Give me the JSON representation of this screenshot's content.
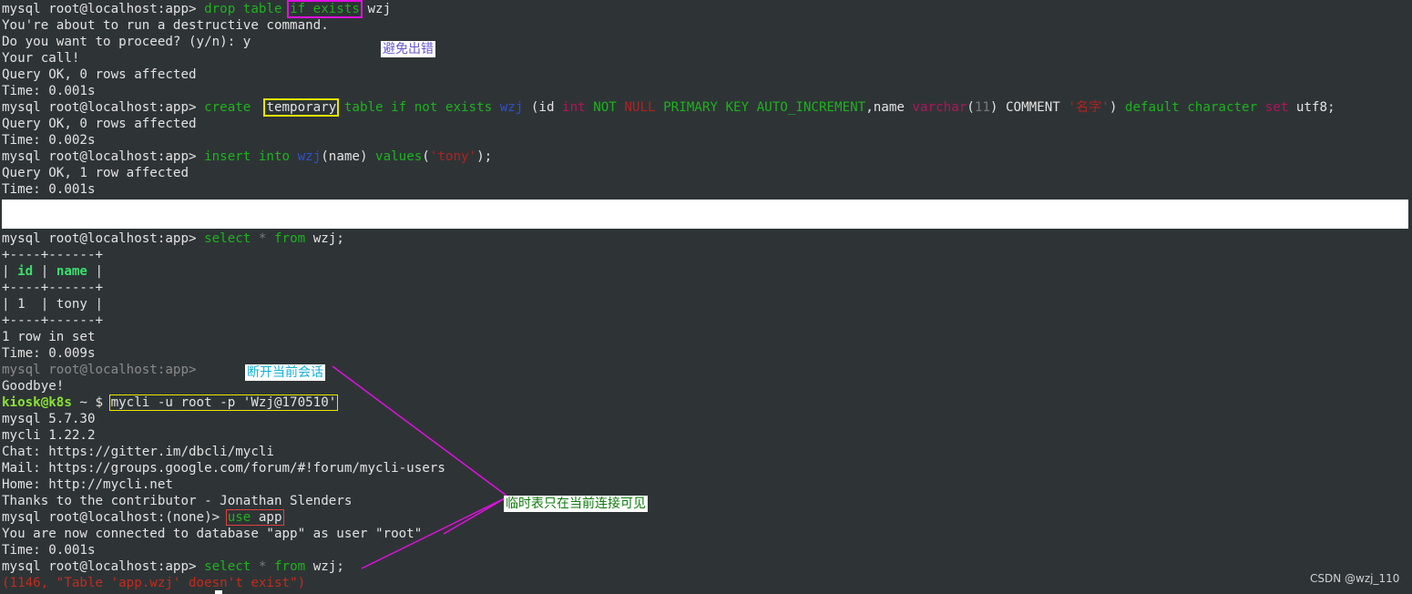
{
  "terminal": {
    "prompt_app": "mysql root@localhost:app>",
    "prompt_none": "mysql root@localhost:(none)>",
    "l1": {
      "kw1": "drop table",
      "boxed": "if exists",
      "name": "wzj"
    },
    "l2": "You're about to run a destructive command.",
    "l3": "Do you want to proceed? (y/n): y",
    "l4": "Your call!",
    "l5": "Query OK, 0 rows affected",
    "l6": "Time: 0.001s",
    "l7": {
      "kw1": "create",
      "boxed": "temporary",
      "kw2": "table if not exists",
      "tbl": "wzj",
      "p1": "(id",
      "typ1": "int",
      "kw3": "NOT",
      "nul": "NULL",
      "kw4": "PRIMARY KEY",
      "kw5": "AUTO_INCREMENT",
      "p2": ",name",
      "typ2": "varchar",
      "p3": "(",
      "num": "11",
      "p4": ") COMMENT",
      "str": "'名字'",
      "p5": ")",
      "kw6": "default character",
      "typ3": "set",
      "p6": "utf8;"
    },
    "l8": "Query OK, 0 rows affected",
    "l9": "Time: 0.002s",
    "l10": {
      "kw1": "insert into",
      "tbl": "wzj",
      "p1": "(name)",
      "kw2": "values",
      "p2": "(",
      "str": "'tony'",
      "p3": ");"
    },
    "l11": "Query OK, 1 row affected",
    "l12": "Time: 0.001s",
    "l13": {
      "kw1": "select",
      "star": "*",
      "kw2": "from",
      "p1": "wzj;"
    },
    "table": {
      "border": "+----+------+",
      "header_left": "| ",
      "col1": "id",
      "header_mid": " | ",
      "col2": "name",
      "header_right": " |",
      "row": "| 1  | tony |"
    },
    "l20": "1 row in set",
    "l21": "Time: 0.009s",
    "l22": "mysql root@localhost:app>",
    "l23": "Goodbye!",
    "l24": {
      "user": "kiosk@k8s",
      "path": "~ $",
      "cmd": "mycli -u root -p 'Wzj@170510'"
    },
    "l25": "mysql 5.7.30",
    "l26": "mycli 1.22.2",
    "l27": "Chat: https://gitter.im/dbcli/mycli",
    "l28": "Mail: https://groups.google.com/forum/#!forum/mycli-users",
    "l29": "Home: http://mycli.net",
    "l30": "Thanks to the contributor - Jonathan Slenders",
    "l31": {
      "kw": "use",
      "arg": "app"
    },
    "l32": "You are now connected to database \"app\" as user \"root\"",
    "l33": "Time: 0.001s",
    "l34": {
      "kw1": "select",
      "star": "*",
      "kw2": "from",
      "p1": "wzj;"
    },
    "l35": "(1146, \"Table 'app.wzj' doesn't exist\")"
  },
  "annotations": {
    "note1": "避免出错",
    "note2": "断开当前会话",
    "note3": "临时表只在当前连接可见"
  },
  "watermark": "CSDN @wzj_110",
  "colors": {
    "background": "#2e3436",
    "keyword": "#1db31d",
    "table_name": "#2f4fd0",
    "type": "#b0155c",
    "error": "#c42a1c",
    "annotation_line": "#e010e0"
  }
}
